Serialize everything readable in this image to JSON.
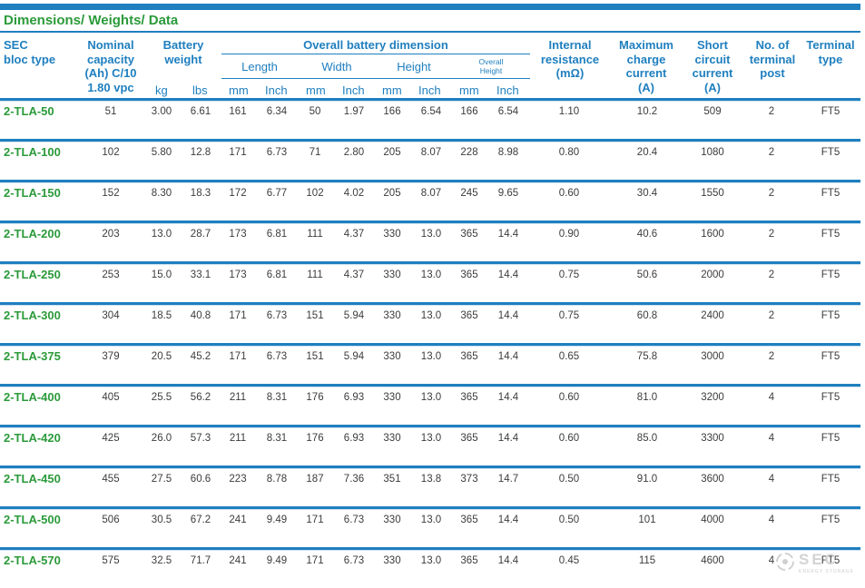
{
  "title": "Dimensions/ Weights/ Data",
  "headers": {
    "sec": "SEC\nbloc type",
    "capacity": "Nominal\ncapacity\n(Ah) C/10\n1.80 vpc",
    "weight": "Battery\nweight",
    "overall": "Overall battery dimension",
    "length": "Length",
    "width": "Width",
    "height": "Height",
    "overall_height": "Overall\nHeight",
    "kg": "kg",
    "lbs": "lbs",
    "mm": "mm",
    "inch": "Inch",
    "resistance": "Internal\nresistance\n(mΩ)",
    "charge": "Maximum\ncharge\ncurrent\n(A)",
    "short": "Short\ncircuit\ncurrent\n(A)",
    "posts": "No. of\nterminal\npost",
    "terminal": "Terminal\ntype"
  },
  "rows": [
    [
      "2-TLA-50",
      "51",
      "3.00",
      "6.61",
      "161",
      "6.34",
      "50",
      "1.97",
      "166",
      "6.54",
      "166",
      "6.54",
      "1.10",
      "10.2",
      "509",
      "2",
      "FT5"
    ],
    [
      "2-TLA-100",
      "102",
      "5.80",
      "12.8",
      "171",
      "6.73",
      "71",
      "2.80",
      "205",
      "8.07",
      "228",
      "8.98",
      "0.80",
      "20.4",
      "1080",
      "2",
      "FT5"
    ],
    [
      "2-TLA-150",
      "152",
      "8.30",
      "18.3",
      "172",
      "6.77",
      "102",
      "4.02",
      "205",
      "8.07",
      "245",
      "9.65",
      "0.60",
      "30.4",
      "1550",
      "2",
      "FT5"
    ],
    [
      "2-TLA-200",
      "203",
      "13.0",
      "28.7",
      "173",
      "6.81",
      "111",
      "4.37",
      "330",
      "13.0",
      "365",
      "14.4",
      "0.90",
      "40.6",
      "1600",
      "2",
      "FT5"
    ],
    [
      "2-TLA-250",
      "253",
      "15.0",
      "33.1",
      "173",
      "6.81",
      "111",
      "4.37",
      "330",
      "13.0",
      "365",
      "14.4",
      "0.75",
      "50.6",
      "2000",
      "2",
      "FT5"
    ],
    [
      "2-TLA-300",
      "304",
      "18.5",
      "40.8",
      "171",
      "6.73",
      "151",
      "5.94",
      "330",
      "13.0",
      "365",
      "14.4",
      "0.75",
      "60.8",
      "2400",
      "2",
      "FT5"
    ],
    [
      "2-TLA-375",
      "379",
      "20.5",
      "45.2",
      "171",
      "6.73",
      "151",
      "5.94",
      "330",
      "13.0",
      "365",
      "14.4",
      "0.65",
      "75.8",
      "3000",
      "2",
      "FT5"
    ],
    [
      "2-TLA-400",
      "405",
      "25.5",
      "56.2",
      "211",
      "8.31",
      "176",
      "6.93",
      "330",
      "13.0",
      "365",
      "14.4",
      "0.60",
      "81.0",
      "3200",
      "4",
      "FT5"
    ],
    [
      "2-TLA-420",
      "425",
      "26.0",
      "57.3",
      "211",
      "8.31",
      "176",
      "6.93",
      "330",
      "13.0",
      "365",
      "14.4",
      "0.60",
      "85.0",
      "3300",
      "4",
      "FT5"
    ],
    [
      "2-TLA-450",
      "455",
      "27.5",
      "60.6",
      "223",
      "8.78",
      "187",
      "7.36",
      "351",
      "13.8",
      "373",
      "14.7",
      "0.50",
      "91.0",
      "3600",
      "4",
      "FT5"
    ],
    [
      "2-TLA-500",
      "506",
      "30.5",
      "67.2",
      "241",
      "9.49",
      "171",
      "6.73",
      "330",
      "13.0",
      "365",
      "14.4",
      "0.50",
      "101",
      "4000",
      "4",
      "FT5"
    ],
    [
      "2-TLA-570",
      "575",
      "32.5",
      "71.7",
      "241",
      "9.49",
      "171",
      "6.73",
      "330",
      "13.0",
      "365",
      "14.4",
      "0.45",
      "115",
      "4600",
      "4",
      "FT5"
    ]
  ],
  "watermark": {
    "text": "SEC",
    "sub": "ENERGY STORAGE"
  }
}
